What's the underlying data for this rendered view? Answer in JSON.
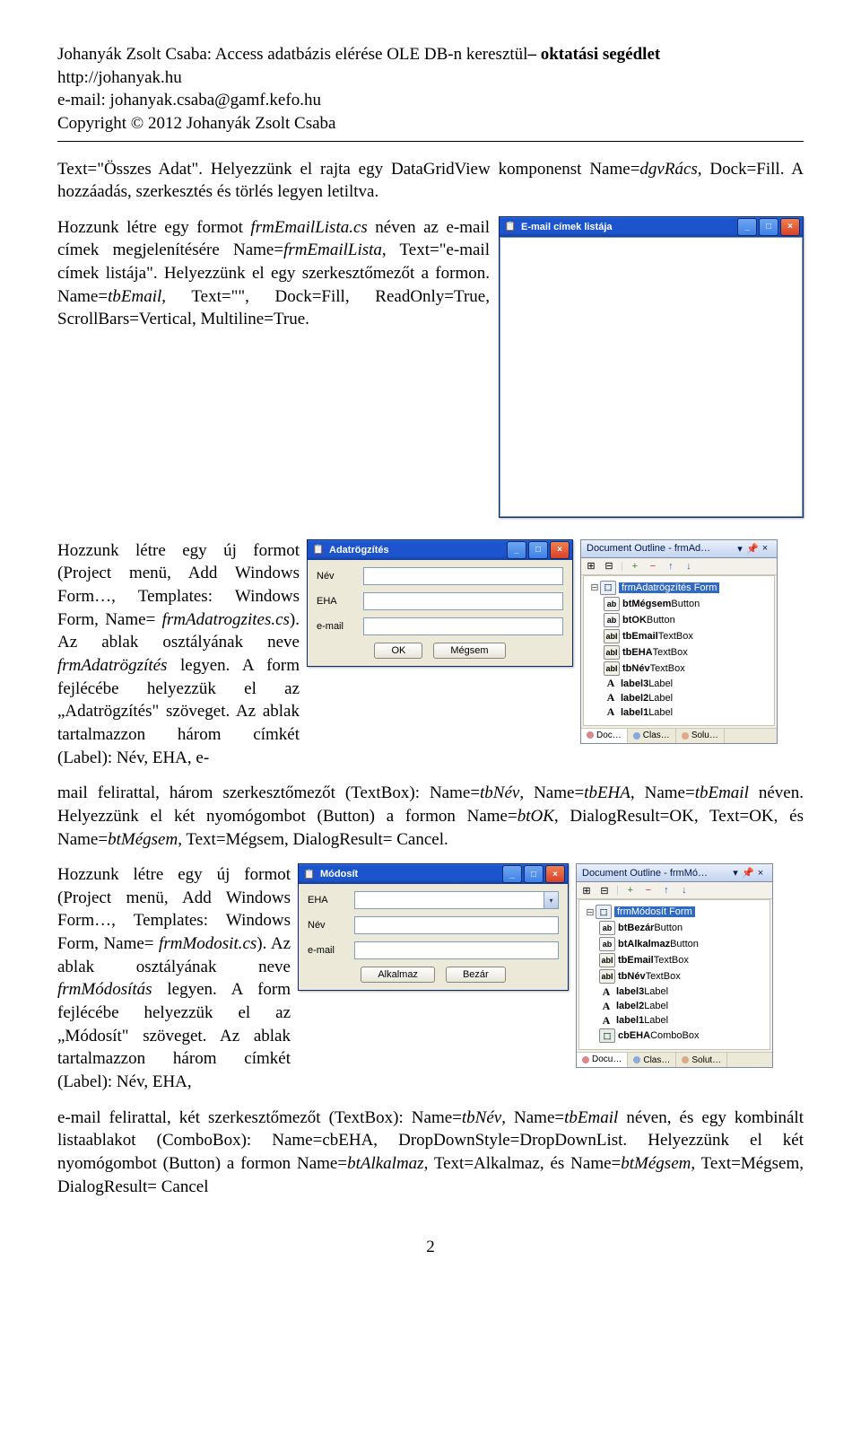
{
  "header": {
    "author_prefix": "Johanyák Zsolt Csaba: ",
    "title_plain": "Access adatbázis elérése OLE DB-n keresztül",
    "title_bold_suffix": "– oktatási segédlet",
    "site": "http://johanyak.hu",
    "email": "e-mail: johanyak.csaba@gamf.kefo.hu",
    "copyright": "Copyright © 2012 Johanyák Zsolt Csaba"
  },
  "para1": {
    "t1": "Text=\"Összes Adat\". Helyezzünk el rajta egy DataGridView komponenst Name=",
    "i1": "dgvRács",
    "t2": ", Dock=Fill. A hozzáadás, szerkesztés és törlés legyen letiltva."
  },
  "para2": {
    "t1": "Hozzunk létre egy formot ",
    "i1": "frmEmailLista.cs",
    "t2": " néven az e-mail címek megjelenítésére Name=",
    "i2": "frmEmailLista",
    "t3": ", Text=\"e-mail címek listája\". Helyezzünk el egy szerkesztőmezőt a formon. Name=",
    "i3": "tbEmail",
    "t4": ", Text=\"\", Dock=Fill, ReadOnly=True, ScrollBars=Vertical, Multiline=True."
  },
  "winEmail": {
    "title": "E-mail címek listája"
  },
  "para3": {
    "t1": "Hozzunk létre egy új formot (Project menü, Add Windows Form…, Templates: Windows Form, Name= ",
    "i1": "frmAdatrogzites.cs",
    "t2": "). Az ablak osztályának neve ",
    "i2": "frmAdatrögzítés",
    "t3": " legyen. A form fejlécébe helyezzük el az „Adatrögzítés\" szöveget. Az ablak tartalmazzon három címkét (Label): Név, EHA, e-"
  },
  "para3_after": {
    "t1": "mail felirattal, három szerkesztőmezőt (TextBox): Name=",
    "i1": "tbNév",
    "t2": ", Name=",
    "i2": "tbEHA",
    "t3": ", Name=",
    "i3": "tbEmail",
    "t4": " néven. Helyezzünk el két nyomógombot (Button) a formon Name=",
    "i4": "btOK",
    "t5": ", DialogResult=OK, Text=OK, és Name=",
    "i5": "btMégsem",
    "t6": ", Text=Mégsem, DialogResult= Cancel."
  },
  "winAdat": {
    "title": "Adatrögzítés",
    "l_nev": "Név",
    "l_eha": "EHA",
    "l_email": "e-mail",
    "btn_ok": "OK",
    "btn_cancel": "Mégsem"
  },
  "outlineA": {
    "title": "Document Outline - frmAd…",
    "root": "frmAdatrögzítés Form",
    "items": [
      {
        "k": "btn",
        "n": "btMégsem",
        "t": "Button"
      },
      {
        "k": "btn",
        "n": "btOK",
        "t": "Button"
      },
      {
        "k": "txt",
        "n": "tbEmail",
        "t": "TextBox"
      },
      {
        "k": "txt",
        "n": "tbEHA",
        "t": "TextBox"
      },
      {
        "k": "txt",
        "n": "tbNév",
        "t": "TextBox"
      },
      {
        "k": "lbl",
        "n": "label3",
        "t": "Label"
      },
      {
        "k": "lbl",
        "n": "label2",
        "t": "Label"
      },
      {
        "k": "lbl",
        "n": "label1",
        "t": "Label"
      }
    ],
    "tabs": [
      "Doc…",
      "Clas…",
      "Solu…"
    ]
  },
  "para4": {
    "t1": "Hozzunk létre egy új formot (Project menü, Add Windows Form…, Templates: Windows Form, Name= ",
    "i1": "frmModosit.cs",
    "t2": "). Az ablak osztályának neve ",
    "i2": "frmMódosítás",
    "t3": " legyen. A form fejlécébe helyezzük el az „Módosít\" szöveget. Az ablak tartalmazzon három címkét (Label): Név, EHA,"
  },
  "para4_after": {
    "t1": "e-mail felirattal, két szerkesztőmezőt (TextBox): Name=",
    "i1": "tbNév",
    "t2": ", Name=",
    "i2": "tbEmail",
    "t3": " néven, és egy kombinált listaablakot (ComboBox): Name=cbEHA, DropDownStyle=DropDownList. Helyezzünk el két nyomógombot (Button) a formon Name=",
    "i3": "btAlkalmaz",
    "t4": ", Text=Alkalmaz, és Name=",
    "i4": "btMégsem",
    "t5": ", Text=Mégsem, DialogResult= Cancel"
  },
  "winMod": {
    "title": "Módosít",
    "l_eha": "EHA",
    "l_nev": "Név",
    "l_email": "e-mail",
    "btn_apply": "Alkalmaz",
    "btn_close": "Bezár"
  },
  "outlineM": {
    "title": "Document Outline - frmMó…",
    "root": "frmMódosít Form",
    "items": [
      {
        "k": "btn",
        "n": "btBezár",
        "t": "Button"
      },
      {
        "k": "btn",
        "n": "btAlkalmaz",
        "t": "Button"
      },
      {
        "k": "txt",
        "n": "tbEmail",
        "t": "TextBox"
      },
      {
        "k": "txt",
        "n": "tbNév",
        "t": "TextBox"
      },
      {
        "k": "lbl",
        "n": "label3",
        "t": "Label"
      },
      {
        "k": "lbl",
        "n": "label2",
        "t": "Label"
      },
      {
        "k": "lbl",
        "n": "label1",
        "t": "Label"
      },
      {
        "k": "cmb",
        "n": "cbEHA",
        "t": "ComboBox"
      }
    ],
    "tabs": [
      "Docu…",
      "Clas…",
      "Solut…"
    ]
  },
  "page_number": "2",
  "icons": {
    "min": "_",
    "max": "□",
    "close": "×",
    "pin": "▾",
    "x": "×",
    "tw_open": "⊟",
    "plus": "+",
    "minus": "−",
    "up": "↑",
    "down": "↓",
    "dd": "▾"
  }
}
